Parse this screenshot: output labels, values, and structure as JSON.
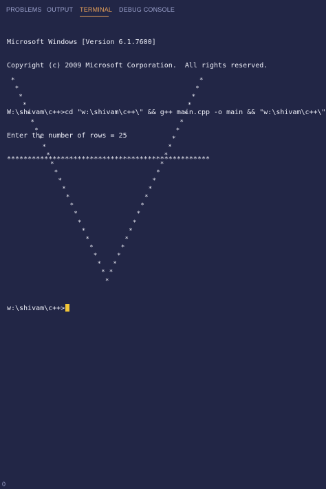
{
  "tabs": [
    {
      "label": "PROBLEMS",
      "active": false
    },
    {
      "label": "OUTPUT",
      "active": false
    },
    {
      "label": "TERMINAL",
      "active": true
    },
    {
      "label": "DEBUG CONSOLE",
      "active": false
    }
  ],
  "terminal": {
    "lines": [
      "Microsoft Windows [Version 6.1.7600]",
      "Copyright (c) 2009 Microsoft Corporation.  All rights reserved.",
      "",
      "W:\\shivam\\c++>cd \"w:\\shivam\\c++\\\" && g++ main.cpp -o main && \"w:\\shivam\\c++\\\"main",
      "Enter the number of rows = 25",
      "*************************************************"
    ],
    "pattern_rows": 25,
    "star_char": "*",
    "prompt": "w:\\shivam\\c++>"
  },
  "status": {
    "count": "0"
  },
  "colors": {
    "background": "#222646",
    "text": "#ecedf6",
    "tab_inactive": "#9ea4cf",
    "tab_active": "#e9a25a",
    "cursor": "#f2c637"
  }
}
